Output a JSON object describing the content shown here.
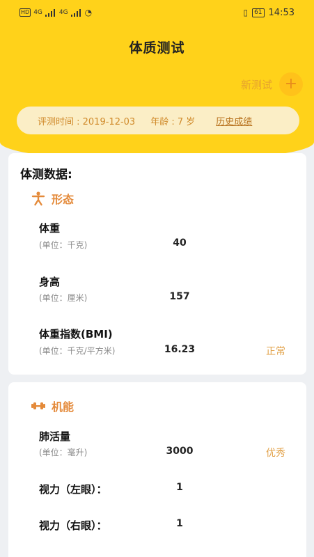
{
  "status_bar": {
    "left_network_a": "4G",
    "left_network_b": "4G",
    "battery": "61",
    "time": "14:53"
  },
  "header": {
    "title": "体质测试",
    "new_test_label": "新测试",
    "plus_symbol": "+"
  },
  "info": {
    "test_time": "评测时间 : 2019-12-03",
    "age": "年龄 : 7 岁",
    "history_link": "历史成绩"
  },
  "card_title": "体测数据:",
  "sections": {
    "morphology": {
      "title": "形态",
      "rows": [
        {
          "label": "体重",
          "unit": "(单位：千克)",
          "value": "40",
          "status": ""
        },
        {
          "label": "身高",
          "unit": "(单位：厘米)",
          "value": "157",
          "status": ""
        },
        {
          "label": "体重指数(BMI)",
          "unit": "(单位：千克/平方米)",
          "value": "16.23",
          "status": "正常"
        }
      ]
    },
    "function": {
      "title": "机能",
      "rows": [
        {
          "label": "肺活量",
          "unit": "(单位：毫升)",
          "value": "3000",
          "status": "优秀"
        },
        {
          "label": "视力（左眼）：",
          "unit": "",
          "value": "1",
          "status": ""
        },
        {
          "label": "视力（右眼）：",
          "unit": "",
          "value": "1",
          "status": ""
        }
      ]
    }
  },
  "colors": {
    "header_bg": "#ffd21a",
    "accent_orange": "#e48a3a",
    "status_text": "#e2a24a"
  }
}
